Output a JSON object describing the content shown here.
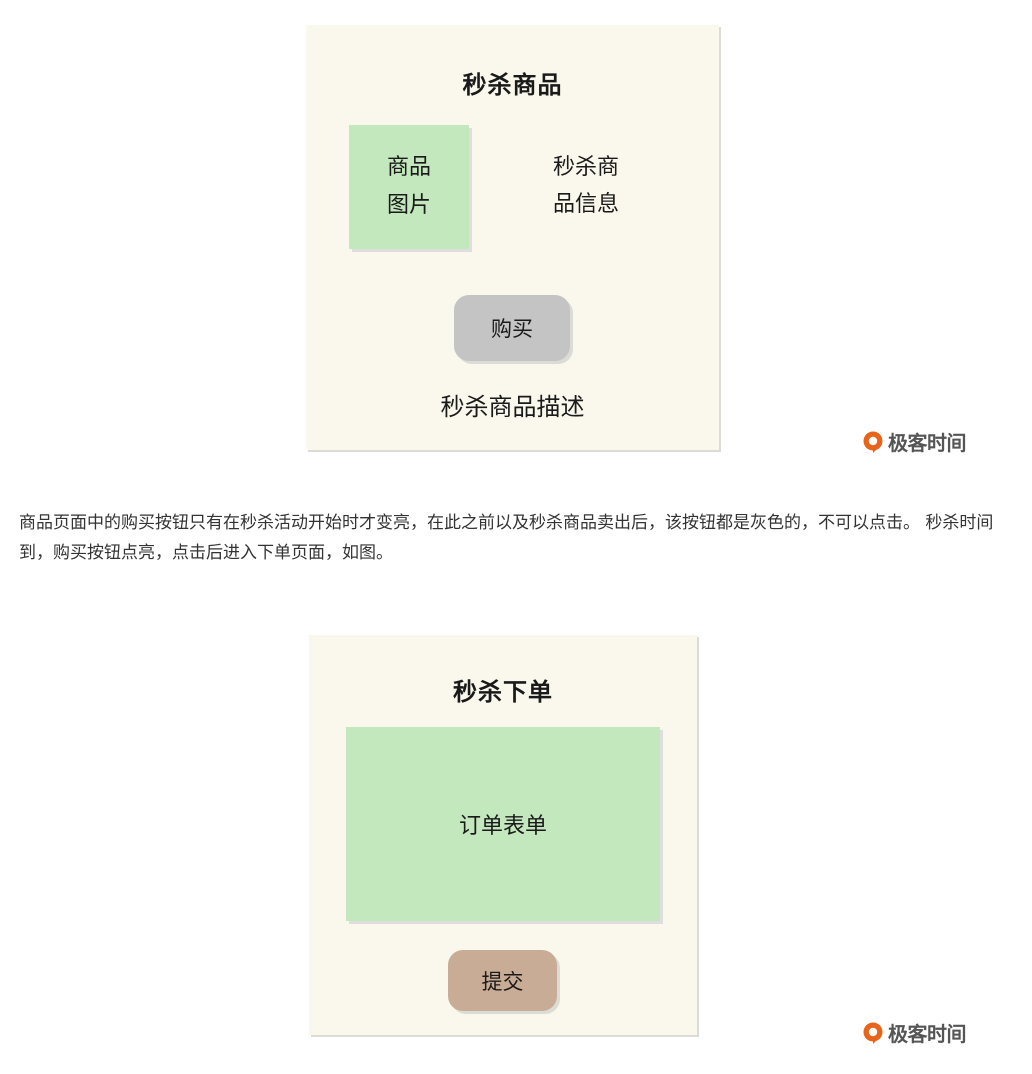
{
  "product_panel": {
    "title": "秒杀商品",
    "image_label_line1": "商品",
    "image_label_line2": "图片",
    "info_line1": "秒杀商",
    "info_line2": "品信息",
    "buy_button": "购买",
    "description": "秒杀商品描述"
  },
  "paragraph": {
    "text": "商品页面中的购买按钮只有在秒杀活动开始时才变亮，在此之前以及秒杀商品卖出后，该按钮都是灰色的，不可以点击。 秒杀时间到，购买按钮点亮，点击后进入下单页面，如图。"
  },
  "order_panel": {
    "title": "秒杀下单",
    "form_label": "订单表单",
    "submit_button": "提交"
  },
  "watermark": {
    "text": "极客时间",
    "icon": "geektime-logo-icon",
    "color": "#e8641b"
  },
  "colors": {
    "panel_bg": "#faf7ec",
    "green_box": "#c4e8bd",
    "buy_button_bg": "#c4c4c4",
    "submit_button_bg": "#c9ac95"
  }
}
